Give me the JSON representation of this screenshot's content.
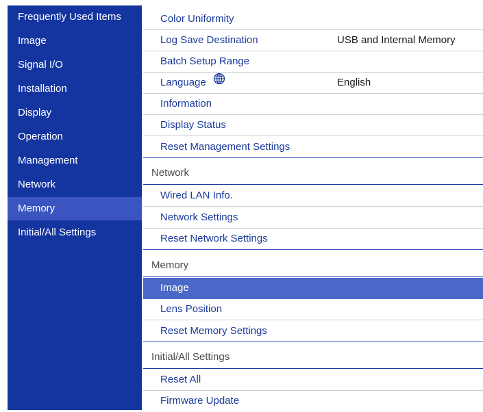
{
  "sidebar": {
    "items": [
      {
        "label": "Frequently Used Items"
      },
      {
        "label": "Image"
      },
      {
        "label": "Signal I/O"
      },
      {
        "label": "Installation"
      },
      {
        "label": "Display"
      },
      {
        "label": "Operation"
      },
      {
        "label": "Management"
      },
      {
        "label": "Network"
      },
      {
        "label": "Memory",
        "active": true
      },
      {
        "label": "Initial/All Settings"
      }
    ]
  },
  "content": {
    "management": [
      {
        "label": "Color Uniformity",
        "value": ""
      },
      {
        "label": "Log Save Destination",
        "value": "USB and Internal Memory"
      },
      {
        "label": "Batch Setup Range",
        "value": ""
      },
      {
        "label": "Language",
        "value": "English",
        "icon": "globe-icon"
      },
      {
        "label": "Information",
        "value": ""
      },
      {
        "label": "Display Status",
        "value": ""
      },
      {
        "label": "Reset Management Settings",
        "value": ""
      }
    ],
    "network_header": "Network",
    "network": [
      {
        "label": "Wired LAN Info."
      },
      {
        "label": "Network Settings"
      },
      {
        "label": "Reset Network Settings"
      }
    ],
    "memory_header": "Memory",
    "memory": [
      {
        "label": "Image",
        "selected": true
      },
      {
        "label": "Lens Position"
      },
      {
        "label": "Reset Memory Settings"
      }
    ],
    "initial_header": "Initial/All Settings",
    "initial": [
      {
        "label": "Reset All"
      },
      {
        "label": "Firmware Update"
      }
    ]
  },
  "colors": {
    "sidebar_bg": "#1435a0",
    "sidebar_active": "#3a55bf",
    "item_text": "#1a3a9c",
    "selected_bg": "#4a68c7"
  }
}
